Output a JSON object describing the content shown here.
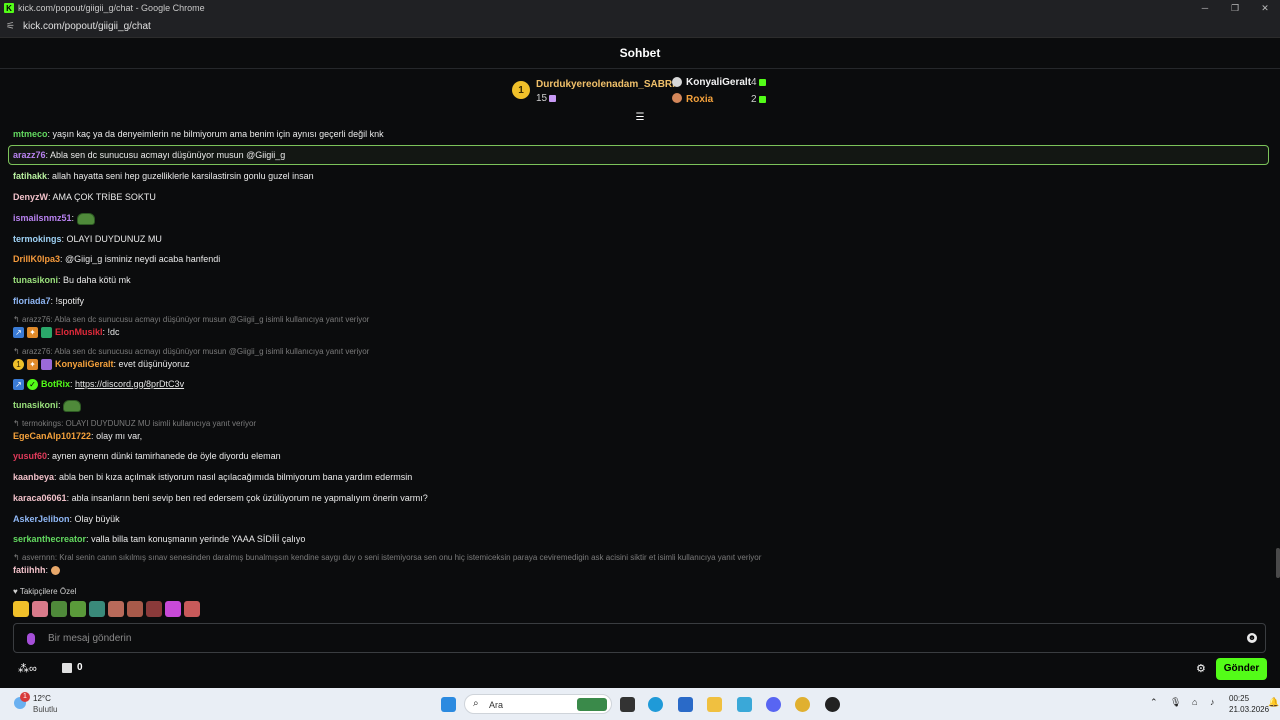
{
  "window": {
    "title": "kick.com/popout/giigii_g/chat - Google Chrome",
    "url": "kick.com/popout/giigii_g/chat"
  },
  "header": {
    "title": "Sohbet"
  },
  "leaderboard": {
    "first": {
      "rank": "1",
      "name": "Durdukyereolenadam_SABRI",
      "count": "15"
    },
    "second": {
      "name": "KonyaliGeralt",
      "count": "4"
    },
    "third": {
      "name": "Roxia",
      "count": "2"
    }
  },
  "messages": {
    "m1": {
      "user": "mtmeco",
      "text": "yaşın kaç ya da denyeimlerin ne bilmiyorum ama benim için aynısı geçerli değil knk"
    },
    "m2": {
      "user": "arazz76",
      "text": "Abla sen dc sunucusu acmayı düşünüyor musun @Giigii_g"
    },
    "m3": {
      "user": "fatihakk",
      "text": "allah hayatta seni hep guzelliklerle karsilastirsin gonlu guzel insan"
    },
    "m4": {
      "user": "DenyzW",
      "text": "AMA ÇOK TRİBE SOKTU"
    },
    "m5": {
      "user": "ismailsnmz51",
      "text": ""
    },
    "m6": {
      "user": "termokings",
      "text": "OLAYI DUYDUNUZ MU"
    },
    "m7": {
      "user": "DrillK0lpa3",
      "text": "@Giigi_g isminiz neydi acaba hanfendi"
    },
    "m8": {
      "user": "tunasikoni",
      "text": "Bu daha kötü mk"
    },
    "m9": {
      "user": "floriada7",
      "text": "!spotify"
    },
    "r10": "arazz76: Abla sen dc sunucusu acmayı düşünüyor musun @Giigii_g isimli kullanıcıya yanıt veriyor",
    "m10": {
      "user": "ElonMusikl",
      "text": "!dc"
    },
    "r11": "arazz76: Abla sen dc sunucusu acmayı düşünüyor musun @Giigii_g isimli kullanıcıya yanıt veriyor",
    "m11": {
      "user": "KonyaliGeralt",
      "text": "evet düşünüyoruz"
    },
    "m12": {
      "user": "BotRix",
      "text": "https://discord.gg/8prDtC3v"
    },
    "m13": {
      "user": "tunasikoni",
      "text": ""
    },
    "r14": "termokings: OLAYI DUYDUNUZ MU isimli kullanıcıya yanıt veriyor",
    "m14": {
      "user": "EgeCanAlp101722",
      "text": "olay mı var,"
    },
    "m15": {
      "user": "yusuf60",
      "text": "aynen aynenn dünki tamirhanede de öyle diyordu eleman"
    },
    "m16": {
      "user": "kaanbeya",
      "text": "abla ben bi kıza açılmak istiyorum nasıl açılacağımıda bilmiyorum bana yardım edermsin"
    },
    "m17": {
      "user": "karaca06061",
      "text": "abla insanların beni sevip ben red edersem çok üzülüyorum ne yapmalıyım önerin varmı?"
    },
    "m18": {
      "user": "AskerJelibon",
      "text": "Olay büyük"
    },
    "m19": {
      "user": "serkanthecreator",
      "text": "valla billa tam konuşmanın yerinde YAAA SİDİİİ çalıyo"
    },
    "r20": "asvernnn: Kral senin canın sıkılmış sınav senesinden daralmış bunalmışsın kendine saygı duy o seni istemiyorsa sen onu hiç istemiceksin paraya ceviremedigin ask acisini siktir et isimli kullanıcıya yanıt veriyor",
    "m20": {
      "user": "fatiihhh",
      "text": ""
    }
  },
  "colors": {
    "mtmeco": "#63d960",
    "arazz76": "#b882f0",
    "fatihakk": "#b8f0a0",
    "DenyzW": "#f0c0c8",
    "ismailsnmz51": "#b882f0",
    "termokings": "#9fd2f5",
    "DrillK0lpa3": "#f59a3c",
    "tunasikoni": "#9ae07c",
    "floriada7": "#8fb7f5",
    "ElonMusikl": "#e02a3a",
    "KonyaliGeralt": "#f5a23c",
    "BotRix": "#53fc18",
    "EgeCanAlp101722": "#f5a23c",
    "yusuf60": "#e03a5a",
    "kaanbeya": "#f0c0c8",
    "karaca06061": "#f0c0c8",
    "AskerJelibon": "#8fb7f5",
    "serkanthecreator": "#63d960",
    "fatiihhh": "#f0c0c8",
    "accent": "#53fc18"
  },
  "subs_label": "Takipçilere Özel",
  "input": {
    "placeholder": "Bir mesaj gönderin"
  },
  "bottom": {
    "points": "0",
    "send_label": "Gönder"
  },
  "taskbar": {
    "weather_temp": "12°C",
    "weather_desc": "Bulutlu",
    "search_placeholder": "Ara",
    "time": "00:25",
    "date": "21.03.2026",
    "notif_count": "1"
  }
}
